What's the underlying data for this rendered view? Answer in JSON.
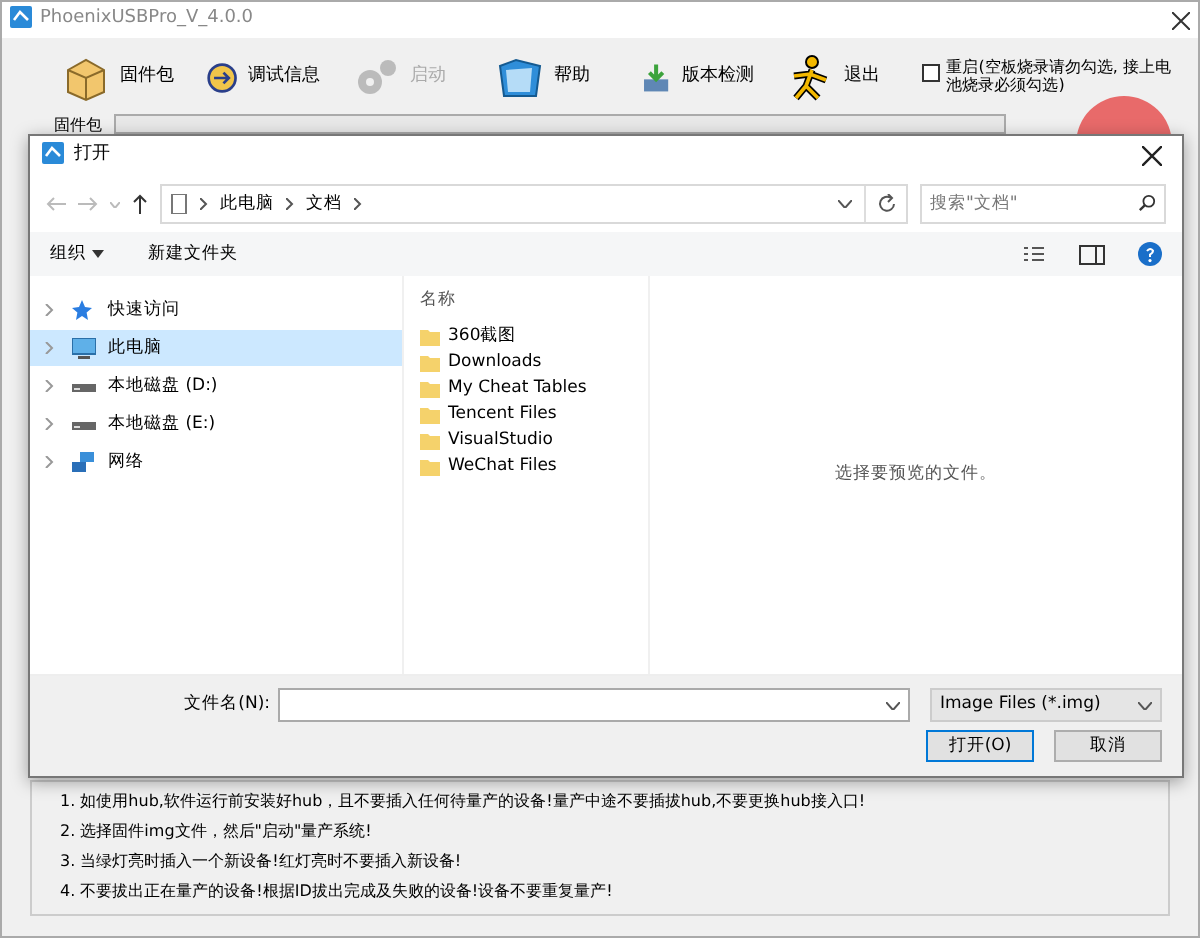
{
  "window": {
    "title": "PhoenixUSBPro_V_4.0.0"
  },
  "toolbar": [
    {
      "kind": "package",
      "label": "固件包",
      "disabled": false
    },
    {
      "kind": "info",
      "label": "调试信息",
      "disabled": false
    },
    {
      "kind": "gear",
      "label": "启动",
      "disabled": true
    },
    {
      "kind": "folder",
      "label": "帮助",
      "disabled": false
    },
    {
      "kind": "download",
      "label": "版本检测",
      "disabled": false
    },
    {
      "kind": "runner",
      "label": "退出",
      "disabled": false
    }
  ],
  "reboot_option": {
    "label": "重启(空板烧录请勿勾选, 接上电池烧录必须勾选)",
    "checked": false
  },
  "firmware": {
    "label": "固件包"
  },
  "instructions": [
    "1. 如使用hub,软件运行前安装好hub，且不要插入任何待量产的设备!量产中途不要插拔hub,不要更换hub接入口!",
    "2. 选择固件img文件，然后\"启动\"量产系统!",
    "3. 当绿灯亮时插入一个新设备!红灯亮时不要插入新设备!",
    "4. 不要拔出正在量产的设备!根据ID拔出完成及失败的设备!设备不要重复量产!"
  ],
  "dialog": {
    "title": "打开",
    "breadcrumb": [
      "此电脑",
      "文档"
    ],
    "search": {
      "placeholder": "搜索\"文档\""
    },
    "commands": [
      {
        "label": "组织",
        "dropdown": true
      },
      {
        "label": "新建文件夹",
        "dropdown": false
      }
    ],
    "nav": [
      {
        "kind": "star",
        "label": "快速访问",
        "selected": false
      },
      {
        "kind": "pc",
        "label": "此电脑",
        "selected": true
      },
      {
        "kind": "drive",
        "label": "本地磁盘 (D:)",
        "selected": false
      },
      {
        "kind": "drive",
        "label": "本地磁盘 (E:)",
        "selected": false
      },
      {
        "kind": "network",
        "label": "网络",
        "selected": false
      }
    ],
    "column": "名称",
    "files": [
      "360截图",
      "Downloads",
      "My Cheat Tables",
      "Tencent Files",
      "VisualStudio",
      "WeChat Files"
    ],
    "preview_message": "选择要预览的文件。",
    "filename_label": "文件名(N):",
    "filter": "Image Files (*.img)",
    "buttons": [
      {
        "label": "打开(O)",
        "primary": true
      },
      {
        "label": "取消",
        "primary": false
      }
    ]
  }
}
